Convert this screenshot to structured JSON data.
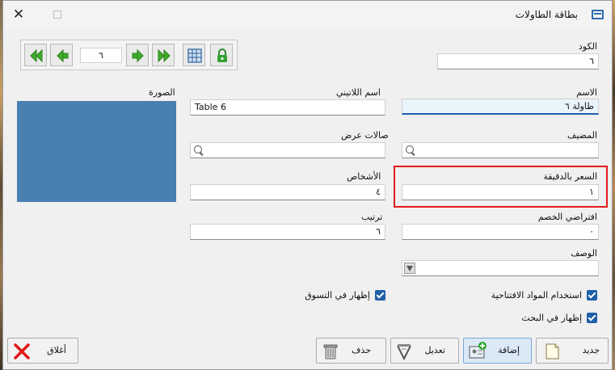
{
  "window": {
    "title": "بطاقة الطاولات",
    "close_glyph": "✕"
  },
  "toolbar": {
    "record_number": "٦",
    "icons": [
      "first-record-icon",
      "previous-record-icon",
      "next-record-icon",
      "last-record-icon",
      "grid-icon",
      "lock-icon"
    ]
  },
  "form": {
    "code_label": "الكود",
    "code_value": "٦",
    "name_label": "الاسم",
    "name_value": "طاولة ٦",
    "latin_name_label": "اسم اللاتيني",
    "latin_name_value": "Table 6",
    "image_label": "الصورة",
    "host_label": "المضيف",
    "host_value": "",
    "halls_label": "صالات عرض",
    "halls_value": "",
    "price_per_minute_label": "السعر بالدقيقة",
    "price_per_minute_value": "١",
    "persons_label": "الأشخاص",
    "persons_value": "٤",
    "default_discount_label": "افتراضي الخصم",
    "default_discount_value": "٠",
    "order_label": "ترتيب",
    "order_value": "٦",
    "description_label": "الوصف",
    "description_value": "",
    "use_opening_materials_label": "استخدام المواد الافتتاحية",
    "show_in_search_label": "إظهار في البحث",
    "show_in_shopping_label": "إظهار في التسوق",
    "use_opening_materials_checked": true,
    "show_in_search_checked": true,
    "show_in_shopping_checked": true
  },
  "footer": {
    "new_label": "جديد",
    "add_label": "إضافة",
    "edit_label": "تعديل",
    "delete_label": "حذف",
    "close_label": "أغلاق"
  },
  "colors": {
    "accent": "#1f5fa8",
    "highlight_border": "#e31b1b",
    "photo_placeholder": "#4a7fb2",
    "nav_arrow": "#3fae2a"
  }
}
